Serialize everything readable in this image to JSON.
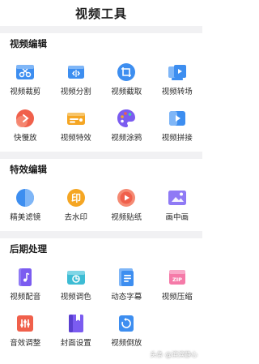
{
  "header": {
    "title": "视频工具"
  },
  "sections": [
    {
      "title": "视频编辑",
      "items": [
        {
          "label": "视频裁剪",
          "icon": "scissors-video-icon"
        },
        {
          "label": "视频分割",
          "icon": "split-video-icon"
        },
        {
          "label": "视频截取",
          "icon": "crop-frame-icon"
        },
        {
          "label": "视频转场",
          "icon": "transition-icon"
        },
        {
          "label": "快慢放",
          "icon": "speed-icon"
        },
        {
          "label": "视频特效",
          "icon": "effects-icon"
        },
        {
          "label": "视频涂鸦",
          "icon": "palette-icon"
        },
        {
          "label": "视频拼接",
          "icon": "merge-video-icon"
        }
      ]
    },
    {
      "title": "特效编辑",
      "items": [
        {
          "label": "精美滤镜",
          "icon": "filter-icon"
        },
        {
          "label": "去水印",
          "icon": "watermark-remove-icon"
        },
        {
          "label": "视频贴纸",
          "icon": "sticker-icon"
        },
        {
          "label": "画中画",
          "icon": "picture-in-picture-icon"
        }
      ]
    },
    {
      "title": "后期处理",
      "items": [
        {
          "label": "视频配音",
          "icon": "dubbing-icon"
        },
        {
          "label": "视频调色",
          "icon": "color-grade-icon"
        },
        {
          "label": "动态字幕",
          "icon": "subtitle-icon"
        },
        {
          "label": "视频压缩",
          "icon": "compress-icon"
        },
        {
          "label": "音效调整",
          "icon": "audio-adjust-icon"
        },
        {
          "label": "封面设置",
          "icon": "cover-icon"
        },
        {
          "label": "视频倒放",
          "icon": "reverse-icon"
        }
      ]
    }
  ],
  "watermark": {
    "text": "头条 @滨滨静心"
  },
  "colors": {
    "blue": "#3d8ef0",
    "orange": "#f5a623",
    "red": "#f0604b",
    "purple": "#7b5cf0",
    "pink": "#f57aa8",
    "divider": "#f1f1f3"
  }
}
